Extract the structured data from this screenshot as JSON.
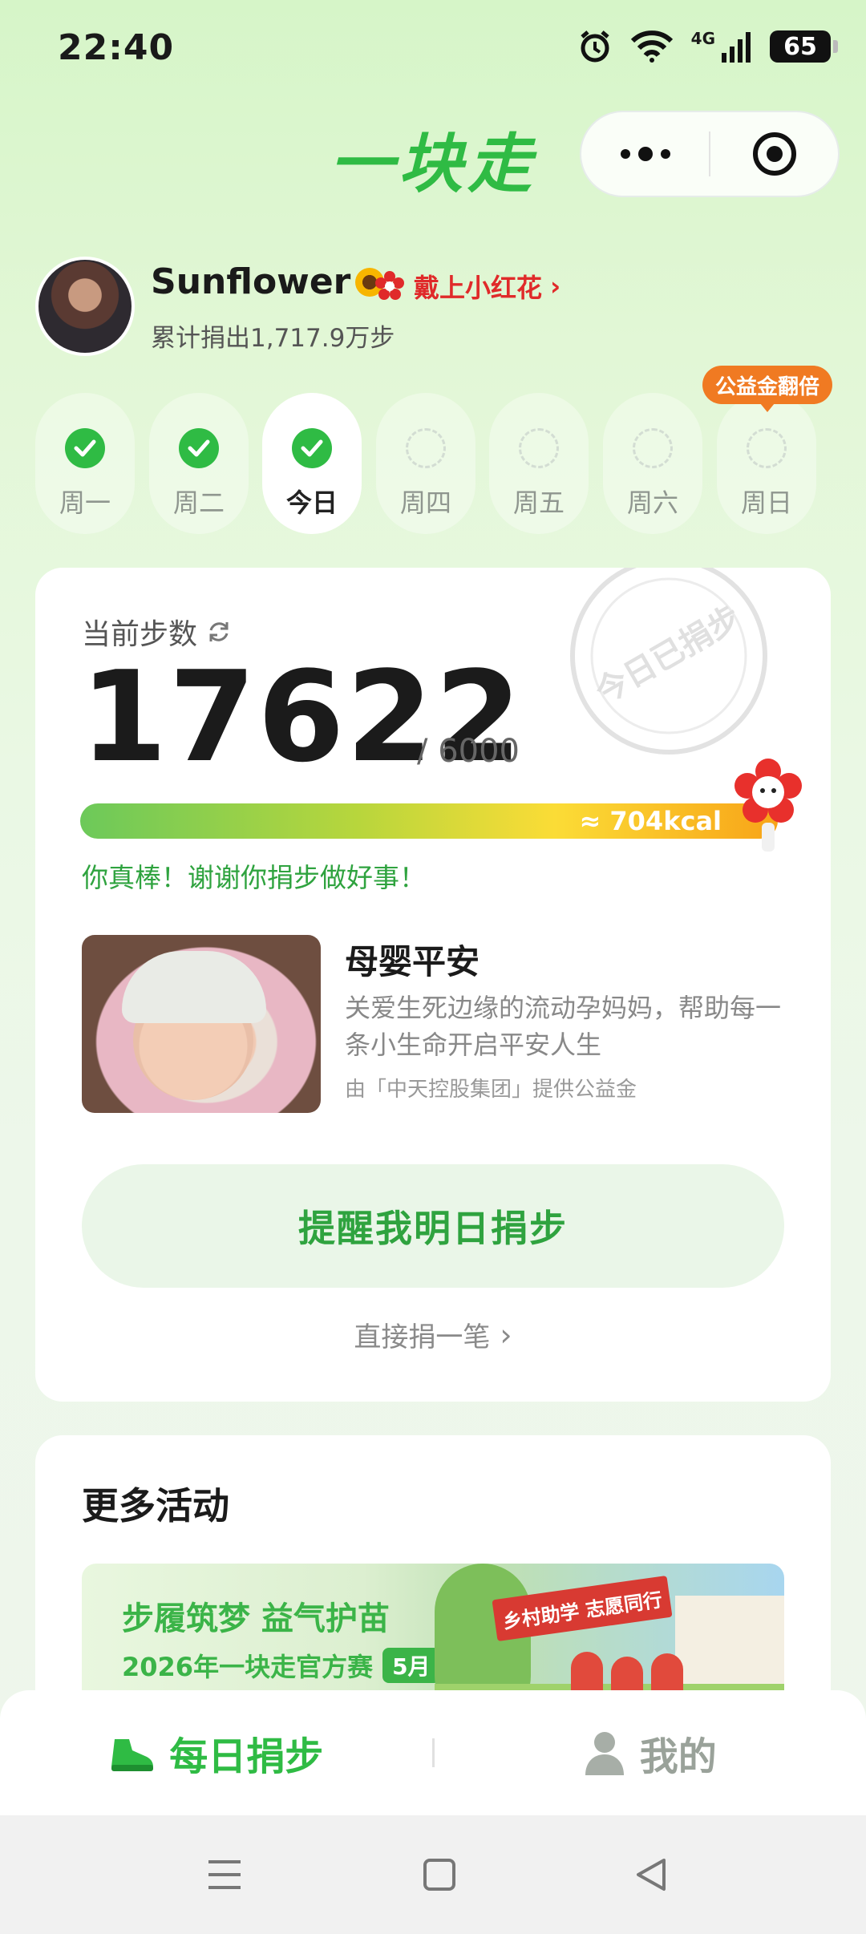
{
  "status_bar": {
    "time": "22:40",
    "network": "4G",
    "battery": "65"
  },
  "header": {
    "title": "一块走",
    "menu_icon": "more-dots-icon",
    "close_icon": "target-close-icon"
  },
  "profile": {
    "name": "Sunflower",
    "red_flower_label": "戴上小红花",
    "total_donated": "累计捐出1,717.9万步"
  },
  "week": {
    "bonus_badge": "公益金翻倍",
    "days": [
      {
        "label": "周一",
        "done": true
      },
      {
        "label": "周二",
        "done": true
      },
      {
        "label": "今日",
        "done": true,
        "active": true
      },
      {
        "label": "周四",
        "done": false
      },
      {
        "label": "周五",
        "done": false
      },
      {
        "label": "周六",
        "done": false
      },
      {
        "label": "周日",
        "done": false
      }
    ]
  },
  "steps": {
    "label": "当前步数",
    "value": "17622",
    "goal": "/ 6000",
    "kcal": "≈ 704kcal",
    "stamp_text": "今日已捐步",
    "praise": "你真棒！谢谢你捐步做好事！"
  },
  "project": {
    "title": "母婴平安",
    "desc": "关爱生死边缘的流动孕妈妈，帮助每一条小生命开启平安人生",
    "sponsor": "由「中天控股集团」提供公益金"
  },
  "actions": {
    "remind": "提醒我明日捐步",
    "direct_donate": "直接捐一笔"
  },
  "more": {
    "title": "更多活动",
    "banner_title": "步履筑梦 益气护苗",
    "banner_sub": "2026年一块走官方赛",
    "banner_month": "5月",
    "banner_flag": "乡村助学 志愿同行"
  },
  "tabs": [
    {
      "label": "每日捐步",
      "icon": "shoe-icon",
      "active": true
    },
    {
      "label": "我的",
      "icon": "person-icon",
      "active": false
    }
  ],
  "colors": {
    "accent": "#2fbb44",
    "orange": "#f07a22",
    "red": "#e02a2a"
  }
}
